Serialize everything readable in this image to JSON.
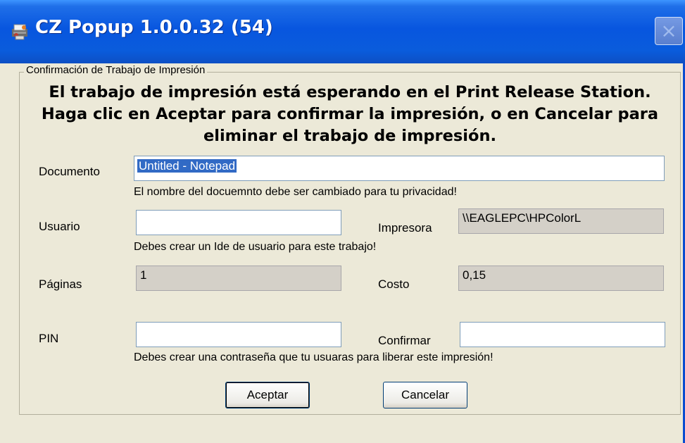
{
  "window": {
    "title": "CZ Popup 1.0.0.32 (54)",
    "close_glyph": "×"
  },
  "group": {
    "legend": "Confirmación de Trabajo de Impresión",
    "heading_line1": "El trabajo de impresión está esperando en el Print Release Station.",
    "heading_line2": "Haga clic en Aceptar para confirmar la impresión, o en Cancelar para",
    "heading_line3": "eliminar el trabajo de impresión."
  },
  "form": {
    "documento_label": "Documento",
    "documento_value": "Untitled - Notepad",
    "documento_hint": "El nombre del docuemnto debe ser cambiado para tu privacidad!",
    "usuario_label": "Usuario",
    "usuario_value": "",
    "usuario_hint": "Debes crear un Ide de usuario para este trabajo!",
    "impresora_label": "Impresora",
    "impresora_value": "\\\\EAGLEPC\\HPColorL",
    "paginas_label": "Páginas",
    "paginas_value": "1",
    "costo_label": "Costo",
    "costo_value": "0,15",
    "pin_label": "PIN",
    "pin_value": "",
    "confirmar_label": "Confirmar",
    "confirmar_value": "",
    "pin_hint": "Debes crear una contraseña que tu usuaras para liberar este impresión!"
  },
  "buttons": {
    "accept_label": "Aceptar",
    "cancel_label": "Cancelar"
  },
  "colors": {
    "titlebar": "#0856DF",
    "dialog_bg": "#ECE9D8",
    "selection": "#316AC5",
    "readonly_bg": "#D4D0C8"
  },
  "icons": {
    "app": "printer-app-icon",
    "close": "close-icon"
  }
}
